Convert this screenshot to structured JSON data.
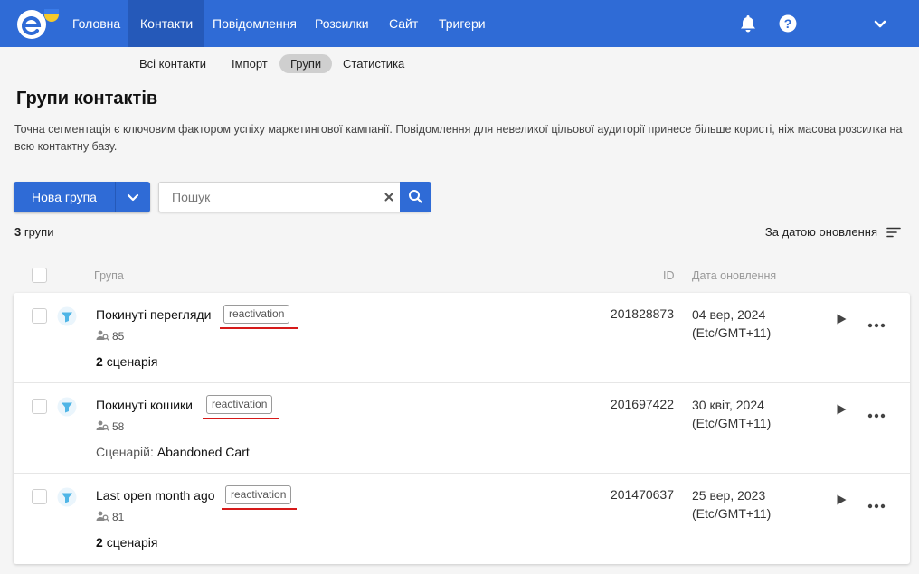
{
  "nav": {
    "items": [
      "Головна",
      "Контакти",
      "Повідомлення",
      "Розсилки",
      "Сайт",
      "Тригери"
    ],
    "active": "Контакти"
  },
  "subnav": {
    "items": [
      "Всі контакти",
      "Імпорт",
      "Групи",
      "Статистика"
    ],
    "active": "Групи"
  },
  "page": {
    "title": "Групи контактів",
    "description": "Точна сегментація є ключовим фактором успіху маркетингової кампанії. Повідомлення для невеликої цільової аудиторії принесе більше користі, ніж масова розсилка на всю контактну базу."
  },
  "toolbar": {
    "new_group": "Нова група",
    "search_placeholder": "Пошук"
  },
  "list": {
    "count": "3",
    "count_label": "групи",
    "sort_label": "За датою оновлення"
  },
  "table": {
    "columns": {
      "group": "Група",
      "id": "ID",
      "updated": "Дата оновлення"
    },
    "rows": [
      {
        "name": "Покинуті перегляди",
        "tag": "reactivation",
        "users": "85",
        "scen_count": "2",
        "scen_label": "сценарія",
        "scen_prefix": "",
        "scen_name": "",
        "id": "201828873",
        "date": "04 вер, 2024",
        "tz": "(Etc/GMT+11)"
      },
      {
        "name": "Покинуті кошики",
        "tag": "reactivation",
        "users": "58",
        "scen_count": "",
        "scen_label": "",
        "scen_prefix": "Сценарій:",
        "scen_name": "Abandoned Cart",
        "id": "201697422",
        "date": "30 квіт, 2024",
        "tz": "(Etc/GMT+11)"
      },
      {
        "name": "Last open month ago",
        "tag": "reactivation",
        "users": "81",
        "scen_count": "2",
        "scen_label": "сценарія",
        "scen_prefix": "",
        "scen_name": "",
        "id": "201470637",
        "date": "25 вер, 2023",
        "tz": "(Etc/GMT+11)"
      }
    ]
  },
  "colors": {
    "primary": "#2f6bd6",
    "nav_active": "#2559b9",
    "highlight_underline": "#d61a1a",
    "segment_icon": "#4fb5e6"
  },
  "icons": [
    "logo-icon",
    "bell-icon",
    "help-icon",
    "chevron-down-icon",
    "clear-icon",
    "search-icon",
    "sort-icon",
    "segment-icon",
    "users-icon",
    "play-icon",
    "more-icon"
  ]
}
